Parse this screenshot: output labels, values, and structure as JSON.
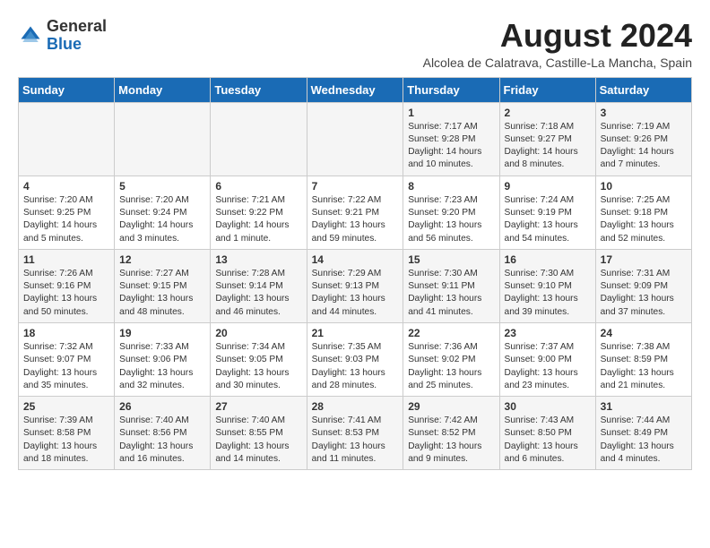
{
  "logo": {
    "general": "General",
    "blue": "Blue"
  },
  "title": {
    "month_year": "August 2024",
    "location": "Alcolea de Calatrava, Castille-La Mancha, Spain"
  },
  "days_of_week": [
    "Sunday",
    "Monday",
    "Tuesday",
    "Wednesday",
    "Thursday",
    "Friday",
    "Saturday"
  ],
  "weeks": [
    [
      {
        "day": "",
        "info": ""
      },
      {
        "day": "",
        "info": ""
      },
      {
        "day": "",
        "info": ""
      },
      {
        "day": "",
        "info": ""
      },
      {
        "day": "1",
        "info": "Sunrise: 7:17 AM\nSunset: 9:28 PM\nDaylight: 14 hours\nand 10 minutes."
      },
      {
        "day": "2",
        "info": "Sunrise: 7:18 AM\nSunset: 9:27 PM\nDaylight: 14 hours\nand 8 minutes."
      },
      {
        "day": "3",
        "info": "Sunrise: 7:19 AM\nSunset: 9:26 PM\nDaylight: 14 hours\nand 7 minutes."
      }
    ],
    [
      {
        "day": "4",
        "info": "Sunrise: 7:20 AM\nSunset: 9:25 PM\nDaylight: 14 hours\nand 5 minutes."
      },
      {
        "day": "5",
        "info": "Sunrise: 7:20 AM\nSunset: 9:24 PM\nDaylight: 14 hours\nand 3 minutes."
      },
      {
        "day": "6",
        "info": "Sunrise: 7:21 AM\nSunset: 9:22 PM\nDaylight: 14 hours\nand 1 minute."
      },
      {
        "day": "7",
        "info": "Sunrise: 7:22 AM\nSunset: 9:21 PM\nDaylight: 13 hours\nand 59 minutes."
      },
      {
        "day": "8",
        "info": "Sunrise: 7:23 AM\nSunset: 9:20 PM\nDaylight: 13 hours\nand 56 minutes."
      },
      {
        "day": "9",
        "info": "Sunrise: 7:24 AM\nSunset: 9:19 PM\nDaylight: 13 hours\nand 54 minutes."
      },
      {
        "day": "10",
        "info": "Sunrise: 7:25 AM\nSunset: 9:18 PM\nDaylight: 13 hours\nand 52 minutes."
      }
    ],
    [
      {
        "day": "11",
        "info": "Sunrise: 7:26 AM\nSunset: 9:16 PM\nDaylight: 13 hours\nand 50 minutes."
      },
      {
        "day": "12",
        "info": "Sunrise: 7:27 AM\nSunset: 9:15 PM\nDaylight: 13 hours\nand 48 minutes."
      },
      {
        "day": "13",
        "info": "Sunrise: 7:28 AM\nSunset: 9:14 PM\nDaylight: 13 hours\nand 46 minutes."
      },
      {
        "day": "14",
        "info": "Sunrise: 7:29 AM\nSunset: 9:13 PM\nDaylight: 13 hours\nand 44 minutes."
      },
      {
        "day": "15",
        "info": "Sunrise: 7:30 AM\nSunset: 9:11 PM\nDaylight: 13 hours\nand 41 minutes."
      },
      {
        "day": "16",
        "info": "Sunrise: 7:30 AM\nSunset: 9:10 PM\nDaylight: 13 hours\nand 39 minutes."
      },
      {
        "day": "17",
        "info": "Sunrise: 7:31 AM\nSunset: 9:09 PM\nDaylight: 13 hours\nand 37 minutes."
      }
    ],
    [
      {
        "day": "18",
        "info": "Sunrise: 7:32 AM\nSunset: 9:07 PM\nDaylight: 13 hours\nand 35 minutes."
      },
      {
        "day": "19",
        "info": "Sunrise: 7:33 AM\nSunset: 9:06 PM\nDaylight: 13 hours\nand 32 minutes."
      },
      {
        "day": "20",
        "info": "Sunrise: 7:34 AM\nSunset: 9:05 PM\nDaylight: 13 hours\nand 30 minutes."
      },
      {
        "day": "21",
        "info": "Sunrise: 7:35 AM\nSunset: 9:03 PM\nDaylight: 13 hours\nand 28 minutes."
      },
      {
        "day": "22",
        "info": "Sunrise: 7:36 AM\nSunset: 9:02 PM\nDaylight: 13 hours\nand 25 minutes."
      },
      {
        "day": "23",
        "info": "Sunrise: 7:37 AM\nSunset: 9:00 PM\nDaylight: 13 hours\nand 23 minutes."
      },
      {
        "day": "24",
        "info": "Sunrise: 7:38 AM\nSunset: 8:59 PM\nDaylight: 13 hours\nand 21 minutes."
      }
    ],
    [
      {
        "day": "25",
        "info": "Sunrise: 7:39 AM\nSunset: 8:58 PM\nDaylight: 13 hours\nand 18 minutes."
      },
      {
        "day": "26",
        "info": "Sunrise: 7:40 AM\nSunset: 8:56 PM\nDaylight: 13 hours\nand 16 minutes."
      },
      {
        "day": "27",
        "info": "Sunrise: 7:40 AM\nSunset: 8:55 PM\nDaylight: 13 hours\nand 14 minutes."
      },
      {
        "day": "28",
        "info": "Sunrise: 7:41 AM\nSunset: 8:53 PM\nDaylight: 13 hours\nand 11 minutes."
      },
      {
        "day": "29",
        "info": "Sunrise: 7:42 AM\nSunset: 8:52 PM\nDaylight: 13 hours\nand 9 minutes."
      },
      {
        "day": "30",
        "info": "Sunrise: 7:43 AM\nSunset: 8:50 PM\nDaylight: 13 hours\nand 6 minutes."
      },
      {
        "day": "31",
        "info": "Sunrise: 7:44 AM\nSunset: 8:49 PM\nDaylight: 13 hours\nand 4 minutes."
      }
    ]
  ]
}
